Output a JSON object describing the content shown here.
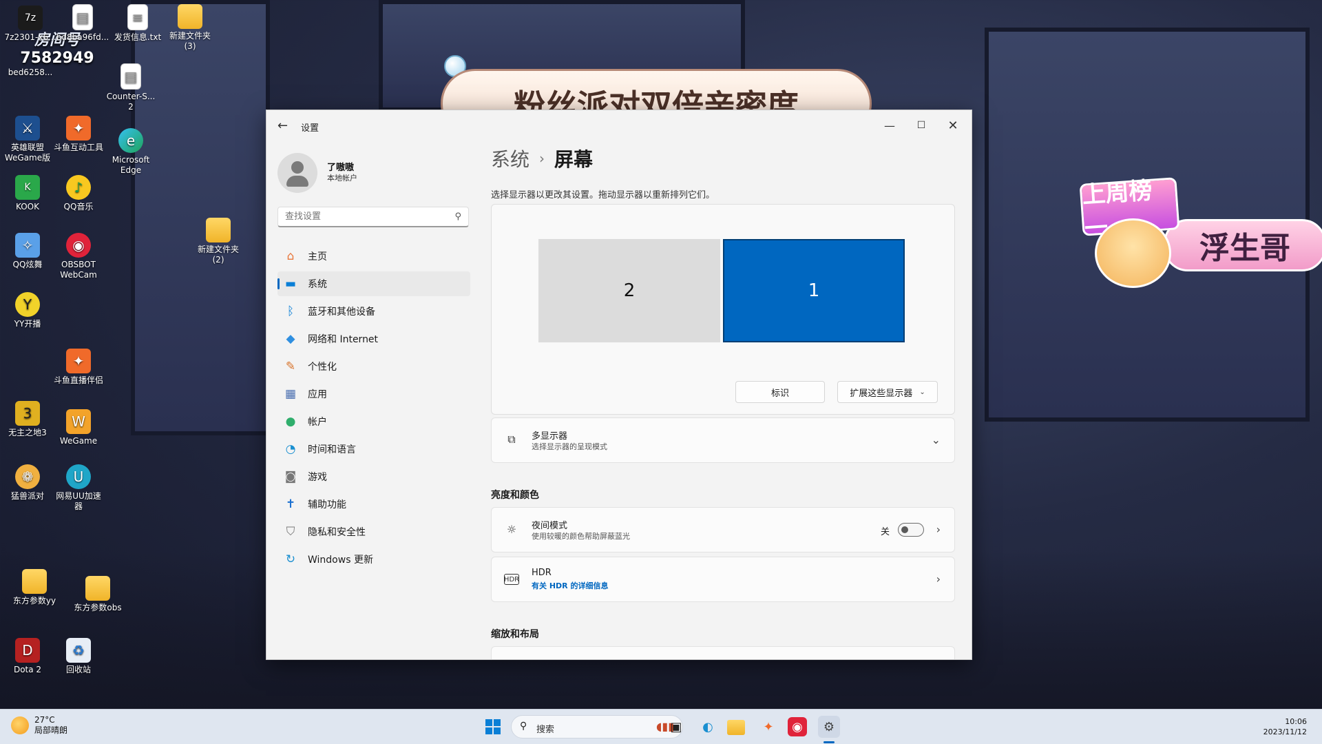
{
  "desktop": {
    "room_badge": {
      "label": "房间号",
      "number": "7582949"
    },
    "icons": [
      {
        "label": "7z2301-x6...",
        "glyph": "7z"
      },
      {
        "label": "bd8ba96fd...",
        "glyph": "▤"
      },
      {
        "label": "发货信息.txt",
        "glyph": "≡"
      },
      {
        "label": "新建文件夹\n(3)",
        "glyph": ""
      },
      {
        "label": "bed6258...",
        "glyph": ""
      },
      {
        "label": "Counter-S...\n2",
        "glyph": "▤"
      },
      {
        "label": "英雄联盟\nWeGame版",
        "glyph": "⚔"
      },
      {
        "label": "斗鱼互动工具",
        "glyph": "✦"
      },
      {
        "label": "Microsoft\nEdge",
        "glyph": "e"
      },
      {
        "label": "KOOK",
        "glyph": "K"
      },
      {
        "label": "QQ音乐",
        "glyph": "♪"
      },
      {
        "label": "新建文件夹\n(2)",
        "glyph": ""
      },
      {
        "label": "QQ炫舞",
        "glyph": "✧"
      },
      {
        "label": "OBSBOT\nWebCam",
        "glyph": "◉"
      },
      {
        "label": "YY开播",
        "glyph": "Y"
      },
      {
        "label": "斗鱼直播伴侣",
        "glyph": "✦"
      },
      {
        "label": "无主之地3",
        "glyph": "3"
      },
      {
        "label": "WeGame",
        "glyph": "W"
      },
      {
        "label": "猛兽派对",
        "glyph": "❁"
      },
      {
        "label": "网易UU加速\n器",
        "glyph": "U"
      },
      {
        "label": "东方参数yy",
        "glyph": ""
      },
      {
        "label": "东方参数obs",
        "glyph": ""
      },
      {
        "label": "Dota 2",
        "glyph": "D"
      },
      {
        "label": "回收站",
        "glyph": "♻"
      }
    ]
  },
  "overlay": {
    "banner": "粉丝派对双倍亲密度",
    "rank_title": "上周榜一",
    "rank_name": "浮生哥"
  },
  "window": {
    "title": "设置",
    "user": {
      "name": "了嗷嗷",
      "type": "本地帐户"
    },
    "search_placeholder": "查找设置",
    "nav": [
      {
        "label": "主页",
        "icon": "home-icon",
        "glyph": "⌂",
        "color": "#e8763a",
        "active": false
      },
      {
        "label": "系统",
        "icon": "system-icon",
        "glyph": "▬",
        "color": "#0a7fd6",
        "active": true
      },
      {
        "label": "蓝牙和其他设备",
        "icon": "bluetooth-icon",
        "glyph": "ᛒ",
        "color": "#0a7fd6",
        "active": false
      },
      {
        "label": "网络和 Internet",
        "icon": "wifi-icon",
        "glyph": "◆",
        "color": "#2f8fe0",
        "active": false
      },
      {
        "label": "个性化",
        "icon": "brush-icon",
        "glyph": "✎",
        "color": "#d8742c",
        "active": false
      },
      {
        "label": "应用",
        "icon": "apps-icon",
        "glyph": "▦",
        "color": "#4a6fb0",
        "active": false
      },
      {
        "label": "帐户",
        "icon": "account-icon",
        "glyph": "●",
        "color": "#2fae6c",
        "active": false
      },
      {
        "label": "时间和语言",
        "icon": "clock-globe-icon",
        "glyph": "◔",
        "color": "#1a8fd0",
        "active": false
      },
      {
        "label": "游戏",
        "icon": "gamepad-icon",
        "glyph": "◙",
        "color": "#777777",
        "active": false
      },
      {
        "label": "辅助功能",
        "icon": "accessibility-icon",
        "glyph": "✝",
        "color": "#1a6fd0",
        "active": false
      },
      {
        "label": "隐私和安全性",
        "icon": "shield-icon",
        "glyph": "⛉",
        "color": "#777777",
        "active": false
      },
      {
        "label": "Windows 更新",
        "icon": "update-icon",
        "glyph": "↻",
        "color": "#1a8fd0",
        "active": false
      }
    ],
    "content": {
      "crumb_parent": "系统",
      "crumb_sep": "›",
      "crumb_current": "屏幕",
      "description": "选择显示器以更改其设置。拖动显示器以重新排列它们。",
      "monitor2": "2",
      "monitor1": "1",
      "identify_btn": "标识",
      "extend_btn": "扩展这些显示器",
      "multi_display": {
        "title": "多显示器",
        "subtitle": "选择显示器的呈现模式"
      },
      "section_brightness": "亮度和颜色",
      "night_light": {
        "title": "夜间模式",
        "subtitle": "使用较暖的颜色帮助屏蔽蓝光",
        "state": "关"
      },
      "hdr": {
        "title": "HDR",
        "subtitle": "有关 HDR 的详细信息"
      },
      "section_scale": "缩放和布局"
    }
  },
  "taskbar": {
    "weather": {
      "temp": "27°C",
      "desc": "局部晴朗"
    },
    "search_label": "搜索",
    "time": "10:06",
    "date": "2023/11/12"
  },
  "colors": {
    "accent": "#0067c0"
  }
}
